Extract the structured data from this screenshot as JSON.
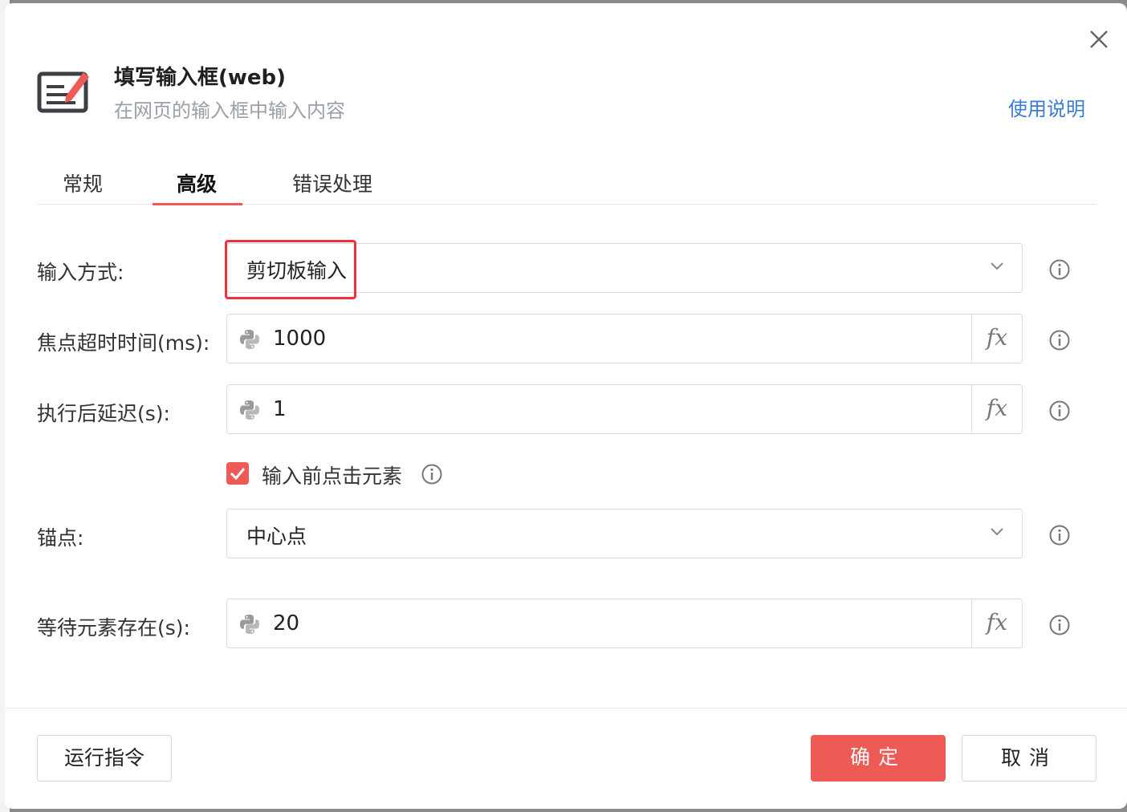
{
  "header": {
    "title": "填写输入框(web)",
    "subtitle": "在网页的输入框中输入内容",
    "help_link": "使用说明"
  },
  "tabs": [
    {
      "label": "常规",
      "active": false
    },
    {
      "label": "高级",
      "active": true
    },
    {
      "label": "错误处理",
      "active": false
    }
  ],
  "form": {
    "input_method": {
      "label": "输入方式:",
      "value": "剪切板输入"
    },
    "focus_timeout": {
      "label": "焦点超时时间(ms):",
      "value": "1000"
    },
    "delay_after": {
      "label": "执行后延迟(s):",
      "value": "1"
    },
    "click_before_input": {
      "label": "输入前点击元素",
      "checked": true
    },
    "anchor": {
      "label": "锚点:",
      "value": "中心点"
    },
    "wait_element": {
      "label": "等待元素存在(s):",
      "value": "20"
    },
    "fx_label": "fx"
  },
  "footer": {
    "run_label": "运行指令",
    "ok_label": "确定",
    "cancel_label": "取消"
  },
  "colors": {
    "accent": "#ee5a55",
    "link": "#3a7bd5",
    "highlight": "#f0313a"
  }
}
